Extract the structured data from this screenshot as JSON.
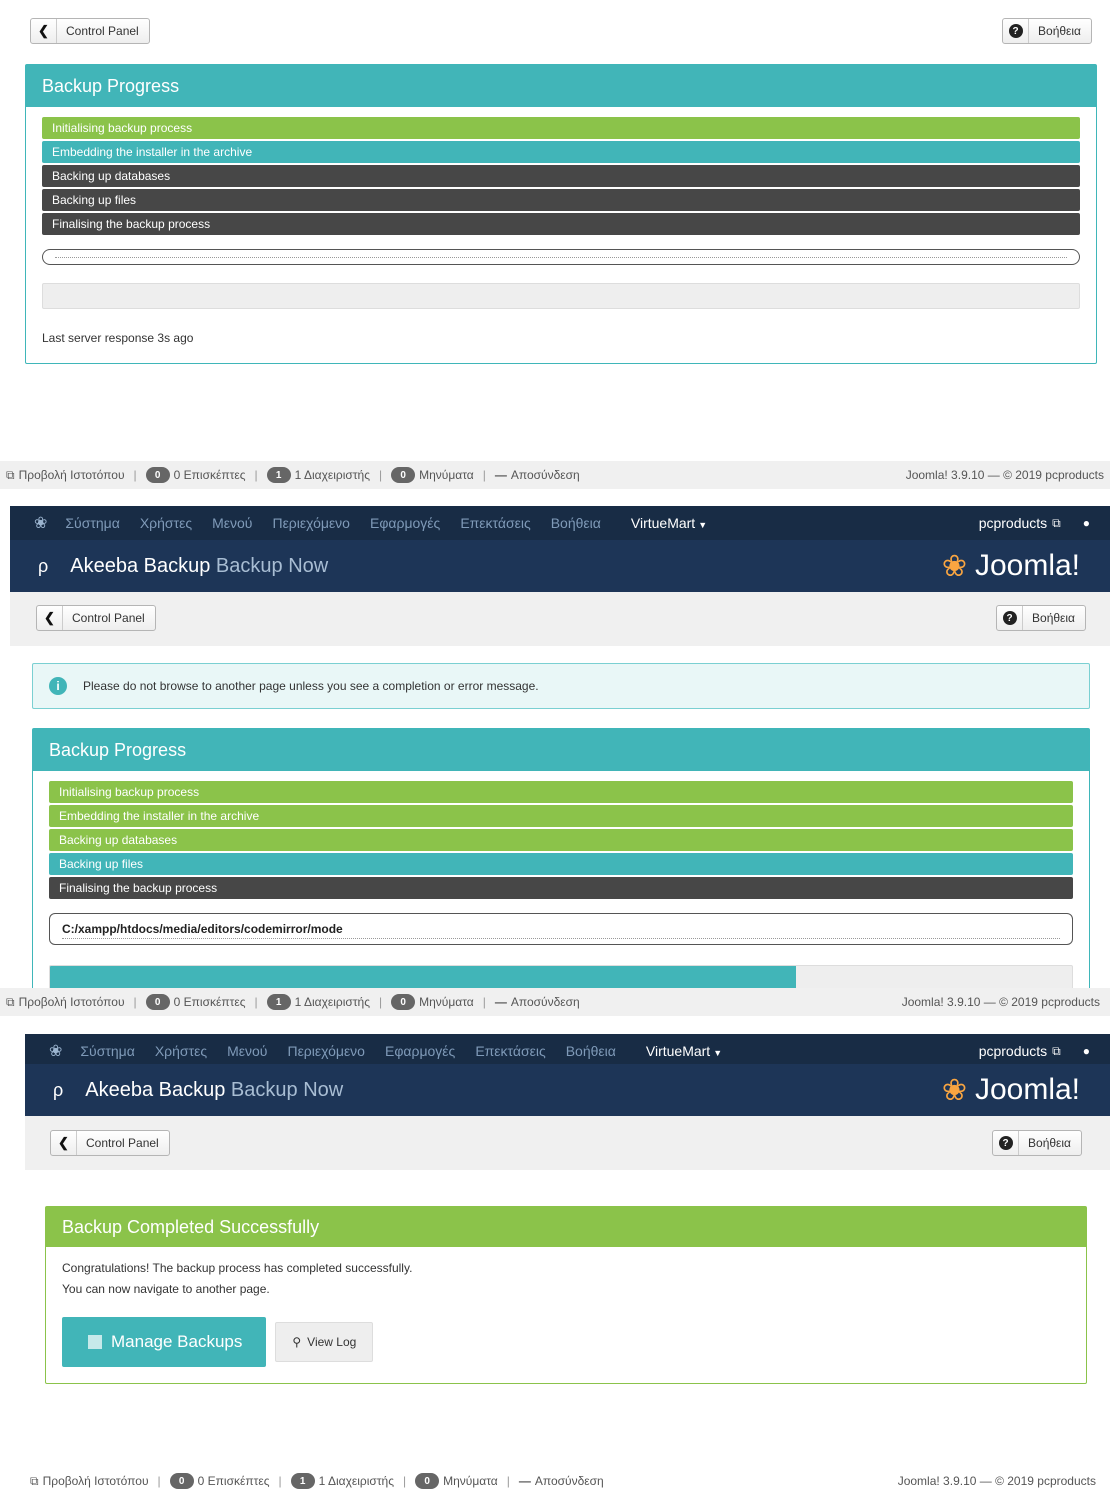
{
  "toolbar": {
    "back_label": "Control Panel",
    "help_label": "Βοήθεια"
  },
  "nav": {
    "menus": [
      "Σύστημα",
      "Χρήστες",
      "Μενού",
      "Περιεχόμενο",
      "Εφαρμογές",
      "Επεκτάσεις",
      "Βοήθεια"
    ],
    "virtuemart": "VirtueMart",
    "site": "pcproducts"
  },
  "header": {
    "app": "Akeeba Backup",
    "page": "Backup Now",
    "brand": "Joomla!"
  },
  "progress_box": {
    "title": "Backup Progress"
  },
  "steps": [
    "Initialising backup process",
    "Embedding the installer in the archive",
    "Backing up databases",
    "Backing up files",
    "Finalising the backup process"
  ],
  "panel1": {
    "last_response": "Last server response 3s ago",
    "step_states": [
      "done",
      "active",
      "pending",
      "pending",
      "pending"
    ],
    "progress_fraction": 0
  },
  "panel2": {
    "info": "Please do not browse to another page unless you see a completion or error message.",
    "current_path": "C:/xampp/htdocs/media/editors/codemirror/mode",
    "step_states": [
      "done",
      "done",
      "done",
      "active",
      "pending"
    ],
    "progress_fraction": 0.73
  },
  "panel3": {
    "success_title": "Backup Completed Successfully",
    "line1": "Congratulations! The backup process has completed successfully.",
    "line2": "You can now navigate to another page.",
    "manage_label": "Manage Backups",
    "viewlog_label": "View Log"
  },
  "statusbar": {
    "view_site": "Προβολή Ιστοτόπου",
    "visitors_count": "0",
    "visitors_label": "0 Επισκέπτες",
    "admins_count": "1",
    "admins_label": "1 Διαχειριστής",
    "messages_count": "0",
    "messages_label": "Μηνύματα",
    "logout": "Αποσύνδεση",
    "version": "Joomla! 3.9.10 — © 2019 pcproducts"
  },
  "colors": {
    "teal": "#41b5b8",
    "green": "#8bc34a",
    "dark": "#474747",
    "navy": "#1d3557"
  }
}
